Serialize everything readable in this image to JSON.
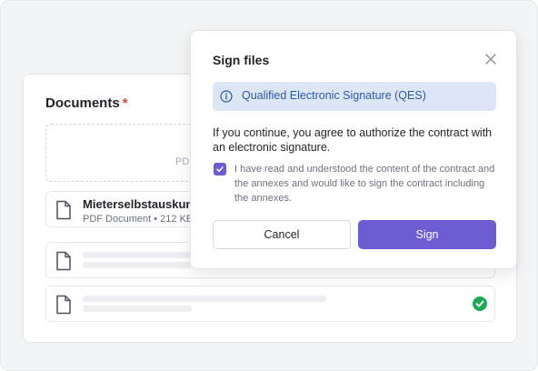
{
  "documents_card": {
    "title": "Documents",
    "required_marker": "*",
    "dropzone_hint": "PDF",
    "files": [
      {
        "name": "Mieterselbstauskunft",
        "meta": "PDF Document • 212 KB"
      },
      {
        "name": "",
        "meta": ""
      },
      {
        "name": "",
        "meta": "",
        "status": "uploaded"
      }
    ]
  },
  "modal": {
    "title": "Sign files",
    "signature_type": "Qualified Electronic Signature (QES)",
    "consent_text": "If you continue, you agree to authorize the contract with an electronic signature.",
    "acknowledgement": "I have read and understood the content of the contract and the annexes and would like to sign the contract including the annexes.",
    "acknowledgement_checked": true,
    "cancel_label": "Cancel",
    "sign_label": "Sign"
  },
  "colors": {
    "accent": "#6c5dd3",
    "info_bg": "#dde6f5",
    "info_text": "#2f5aa8",
    "required": "#e03e36",
    "success": "#1fa855"
  },
  "icons": [
    "file-icon",
    "check-circle-icon",
    "close-icon",
    "info-icon",
    "checkmark-icon"
  ]
}
